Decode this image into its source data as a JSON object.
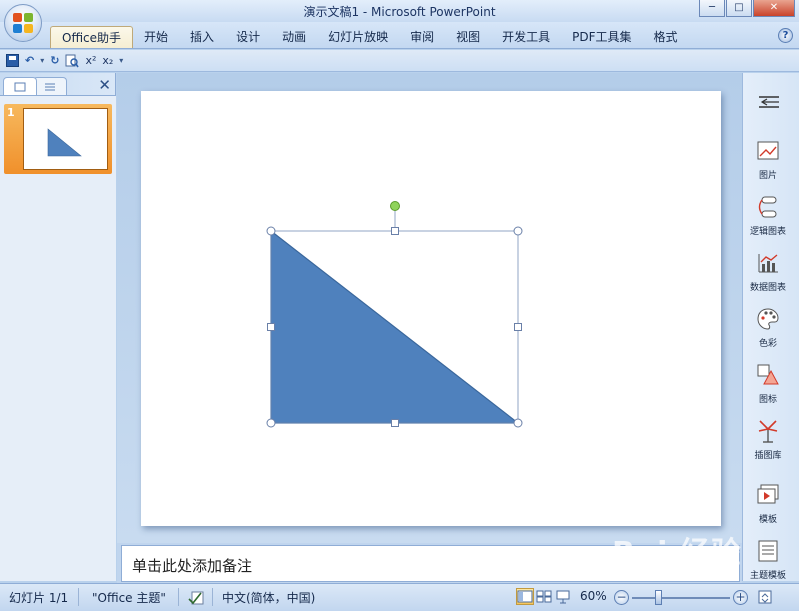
{
  "window": {
    "title": "演示文稿1 - Microsoft PowerPoint",
    "minimize": "─",
    "maximize": "□",
    "close": "✕"
  },
  "ribbon": {
    "tabs": [
      {
        "label": "Office助手",
        "active": true
      },
      {
        "label": "开始"
      },
      {
        "label": "插入"
      },
      {
        "label": "设计"
      },
      {
        "label": "动画"
      },
      {
        "label": "幻灯片放映"
      },
      {
        "label": "审阅"
      },
      {
        "label": "视图"
      },
      {
        "label": "开发工具"
      },
      {
        "label": "PDF工具集"
      },
      {
        "label": "格式"
      }
    ],
    "help": "?"
  },
  "qat": {
    "superscript": "x²",
    "subscript": "x₂",
    "dropdown": "▾",
    "undo_dropdown": "▾",
    "undo": "↶",
    "redo": "↻"
  },
  "slide_panel": {
    "close": "✕",
    "slides": [
      {
        "number": "1"
      }
    ]
  },
  "side_pane": {
    "items": [
      {
        "label": "图片",
        "icon": "picture-icon"
      },
      {
        "label": "逻辑图表",
        "icon": "logic-chart-icon"
      },
      {
        "label": "数据图表",
        "icon": "data-chart-icon"
      },
      {
        "label": "色彩",
        "icon": "palette-icon"
      },
      {
        "label": "图标",
        "icon": "shapes-icon"
      },
      {
        "label": "插图库",
        "icon": "illustration-icon"
      },
      {
        "label": "模板",
        "icon": "template-icon"
      },
      {
        "label": "主题模板",
        "icon": "theme-template-icon"
      }
    ]
  },
  "notes": {
    "placeholder": "单击此处添加备注"
  },
  "status": {
    "slide": "幻灯片 1/1",
    "theme": "\"Office 主题\"",
    "language": "中文(简体，中国)",
    "zoom": "60%",
    "zoom_minus": "−",
    "zoom_plus": "+",
    "zoom_level": 0.6
  },
  "watermark": "Bai 经验",
  "colors": {
    "shape_fill": "#4f81bd",
    "shape_stroke": "#3a679c",
    "selection": "#7690b8",
    "rotate_handle": "#8fd35a",
    "thumb_selected": "#f0902b"
  }
}
